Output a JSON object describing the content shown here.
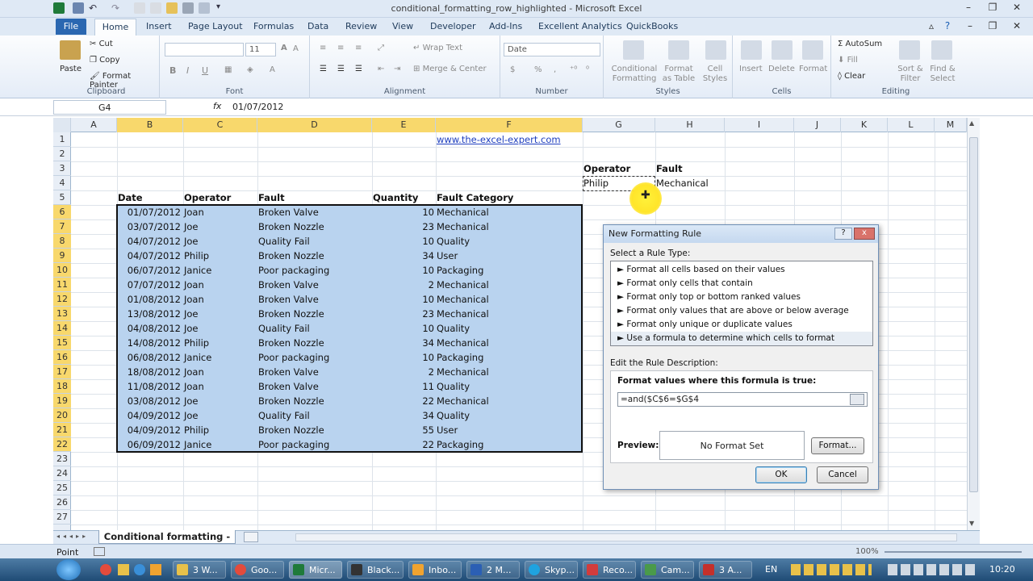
{
  "window": {
    "title": "conditional_formatting_row_highlighted - Microsoft Excel"
  },
  "tabs": [
    "File",
    "Home",
    "Insert",
    "Page Layout",
    "Formulas",
    "Data",
    "Review",
    "View",
    "Developer",
    "Add-Ins",
    "Excellent Analytics",
    "QuickBooks"
  ],
  "ribbon": {
    "clipboard": {
      "label": "Clipboard",
      "paste": "Paste",
      "cut": "Cut",
      "copy": "Copy",
      "format_painter": "Format Painter"
    },
    "font": {
      "label": "Font",
      "size": "11",
      "bold": "B",
      "italic": "I",
      "underline": "U"
    },
    "alignment": {
      "label": "Alignment",
      "wrap": "Wrap Text",
      "merge": "Merge & Center"
    },
    "number": {
      "label": "Number",
      "format": "Date",
      "percent": "%",
      "comma": ","
    },
    "styles": {
      "label": "Styles",
      "cond1": "Conditional",
      "cond2": "Formatting",
      "fmt1": "Format",
      "fmt2": "as Table",
      "cell1": "Cell",
      "cell2": "Styles"
    },
    "cells": {
      "label": "Cells",
      "insert": "Insert",
      "delete": "Delete",
      "format": "Format"
    },
    "editing": {
      "label": "Editing",
      "autosum": "AutoSum",
      "fill": "Fill",
      "clear": "Clear",
      "sort1": "Sort &",
      "sort2": "Filter",
      "find1": "Find &",
      "find2": "Select"
    }
  },
  "formula_bar": {
    "name_box": "G4",
    "fx": "fx",
    "value": "01/07/2012"
  },
  "columns": [
    "A",
    "B",
    "C",
    "D",
    "E",
    "F",
    "G",
    "H",
    "I",
    "J",
    "K",
    "L",
    "M"
  ],
  "rows": [
    "1",
    "2",
    "3",
    "4",
    "5",
    "6",
    "7",
    "8",
    "9",
    "10",
    "11",
    "12",
    "13",
    "14",
    "15",
    "16",
    "17",
    "18",
    "19",
    "20",
    "21",
    "22",
    "23",
    "24",
    "25",
    "26",
    "27"
  ],
  "cells": {
    "link": "www.the-excel-expert.com",
    "criteria_headers": [
      "Operator",
      "Fault"
    ],
    "criteria_values": [
      "Philip",
      "Mechanical"
    ],
    "table_headers": [
      "Date",
      "Operator",
      "Fault",
      "Quantity",
      "Fault Category"
    ],
    "table_rows": [
      [
        "01/07/2012",
        "Joan",
        "Broken Valve",
        "10",
        "Mechanical"
      ],
      [
        "03/07/2012",
        "Joe",
        "Broken Nozzle",
        "23",
        "Mechanical"
      ],
      [
        "04/07/2012",
        "Joe",
        "Quality Fail",
        "10",
        "Quality"
      ],
      [
        "04/07/2012",
        "Philip",
        "Broken Nozzle",
        "34",
        "User"
      ],
      [
        "06/07/2012",
        "Janice",
        "Poor packaging",
        "10",
        "Packaging"
      ],
      [
        "07/07/2012",
        "Joan",
        "Broken Valve",
        "2",
        "Mechanical"
      ],
      [
        "01/08/2012",
        "Joan",
        "Broken Valve",
        "10",
        "Mechanical"
      ],
      [
        "13/08/2012",
        "Joe",
        "Broken Nozzle",
        "23",
        "Mechanical"
      ],
      [
        "04/08/2012",
        "Joe",
        "Quality Fail",
        "10",
        "Quality"
      ],
      [
        "14/08/2012",
        "Philip",
        "Broken Nozzle",
        "34",
        "Mechanical"
      ],
      [
        "06/08/2012",
        "Janice",
        "Poor packaging",
        "10",
        "Packaging"
      ],
      [
        "18/08/2012",
        "Joan",
        "Broken Valve",
        "2",
        "Mechanical"
      ],
      [
        "11/08/2012",
        "Joan",
        "Broken Valve",
        "11",
        "Quality"
      ],
      [
        "03/08/2012",
        "Joe",
        "Broken Nozzle",
        "22",
        "Mechanical"
      ],
      [
        "04/09/2012",
        "Joe",
        "Quality Fail",
        "34",
        "Quality"
      ],
      [
        "04/09/2012",
        "Philip",
        "Broken Nozzle",
        "55",
        "User"
      ],
      [
        "06/09/2012",
        "Janice",
        "Poor packaging",
        "22",
        "Packaging"
      ]
    ]
  },
  "sheet": {
    "tab": "Conditional formatting - row"
  },
  "status": {
    "mode": "Point",
    "zoom": "100%"
  },
  "dialog": {
    "title": "New Formatting Rule",
    "help": "?",
    "close": "x",
    "select_label": "Select a Rule Type:",
    "rule_types": [
      "► Format all cells based on their values",
      "► Format only cells that contain",
      "► Format only top or bottom ranked values",
      "► Format only values that are above or below average",
      "► Format only unique or duplicate values",
      "► Use a formula to determine which cells to format"
    ],
    "edit_label": "Edit the Rule Description:",
    "formula_label": "Format values where this formula is true:",
    "formula": "=and($C$6=$G$4",
    "preview_label": "Preview:",
    "preview_text": "No Format Set",
    "format_button": "Format...",
    "ok": "OK",
    "cancel": "Cancel"
  },
  "taskbar": {
    "items": [
      "3 W...",
      "Goo...",
      "Micr...",
      "Black...",
      "Inbo...",
      "2 M...",
      "Skyp...",
      "Reco...",
      "Cam...",
      "3 A..."
    ],
    "lang": "EN",
    "clock": "10:20"
  },
  "colors": {
    "accent": "#2a67b1",
    "selection": "#b9d3ef",
    "highlight": "#f8d86c"
  }
}
